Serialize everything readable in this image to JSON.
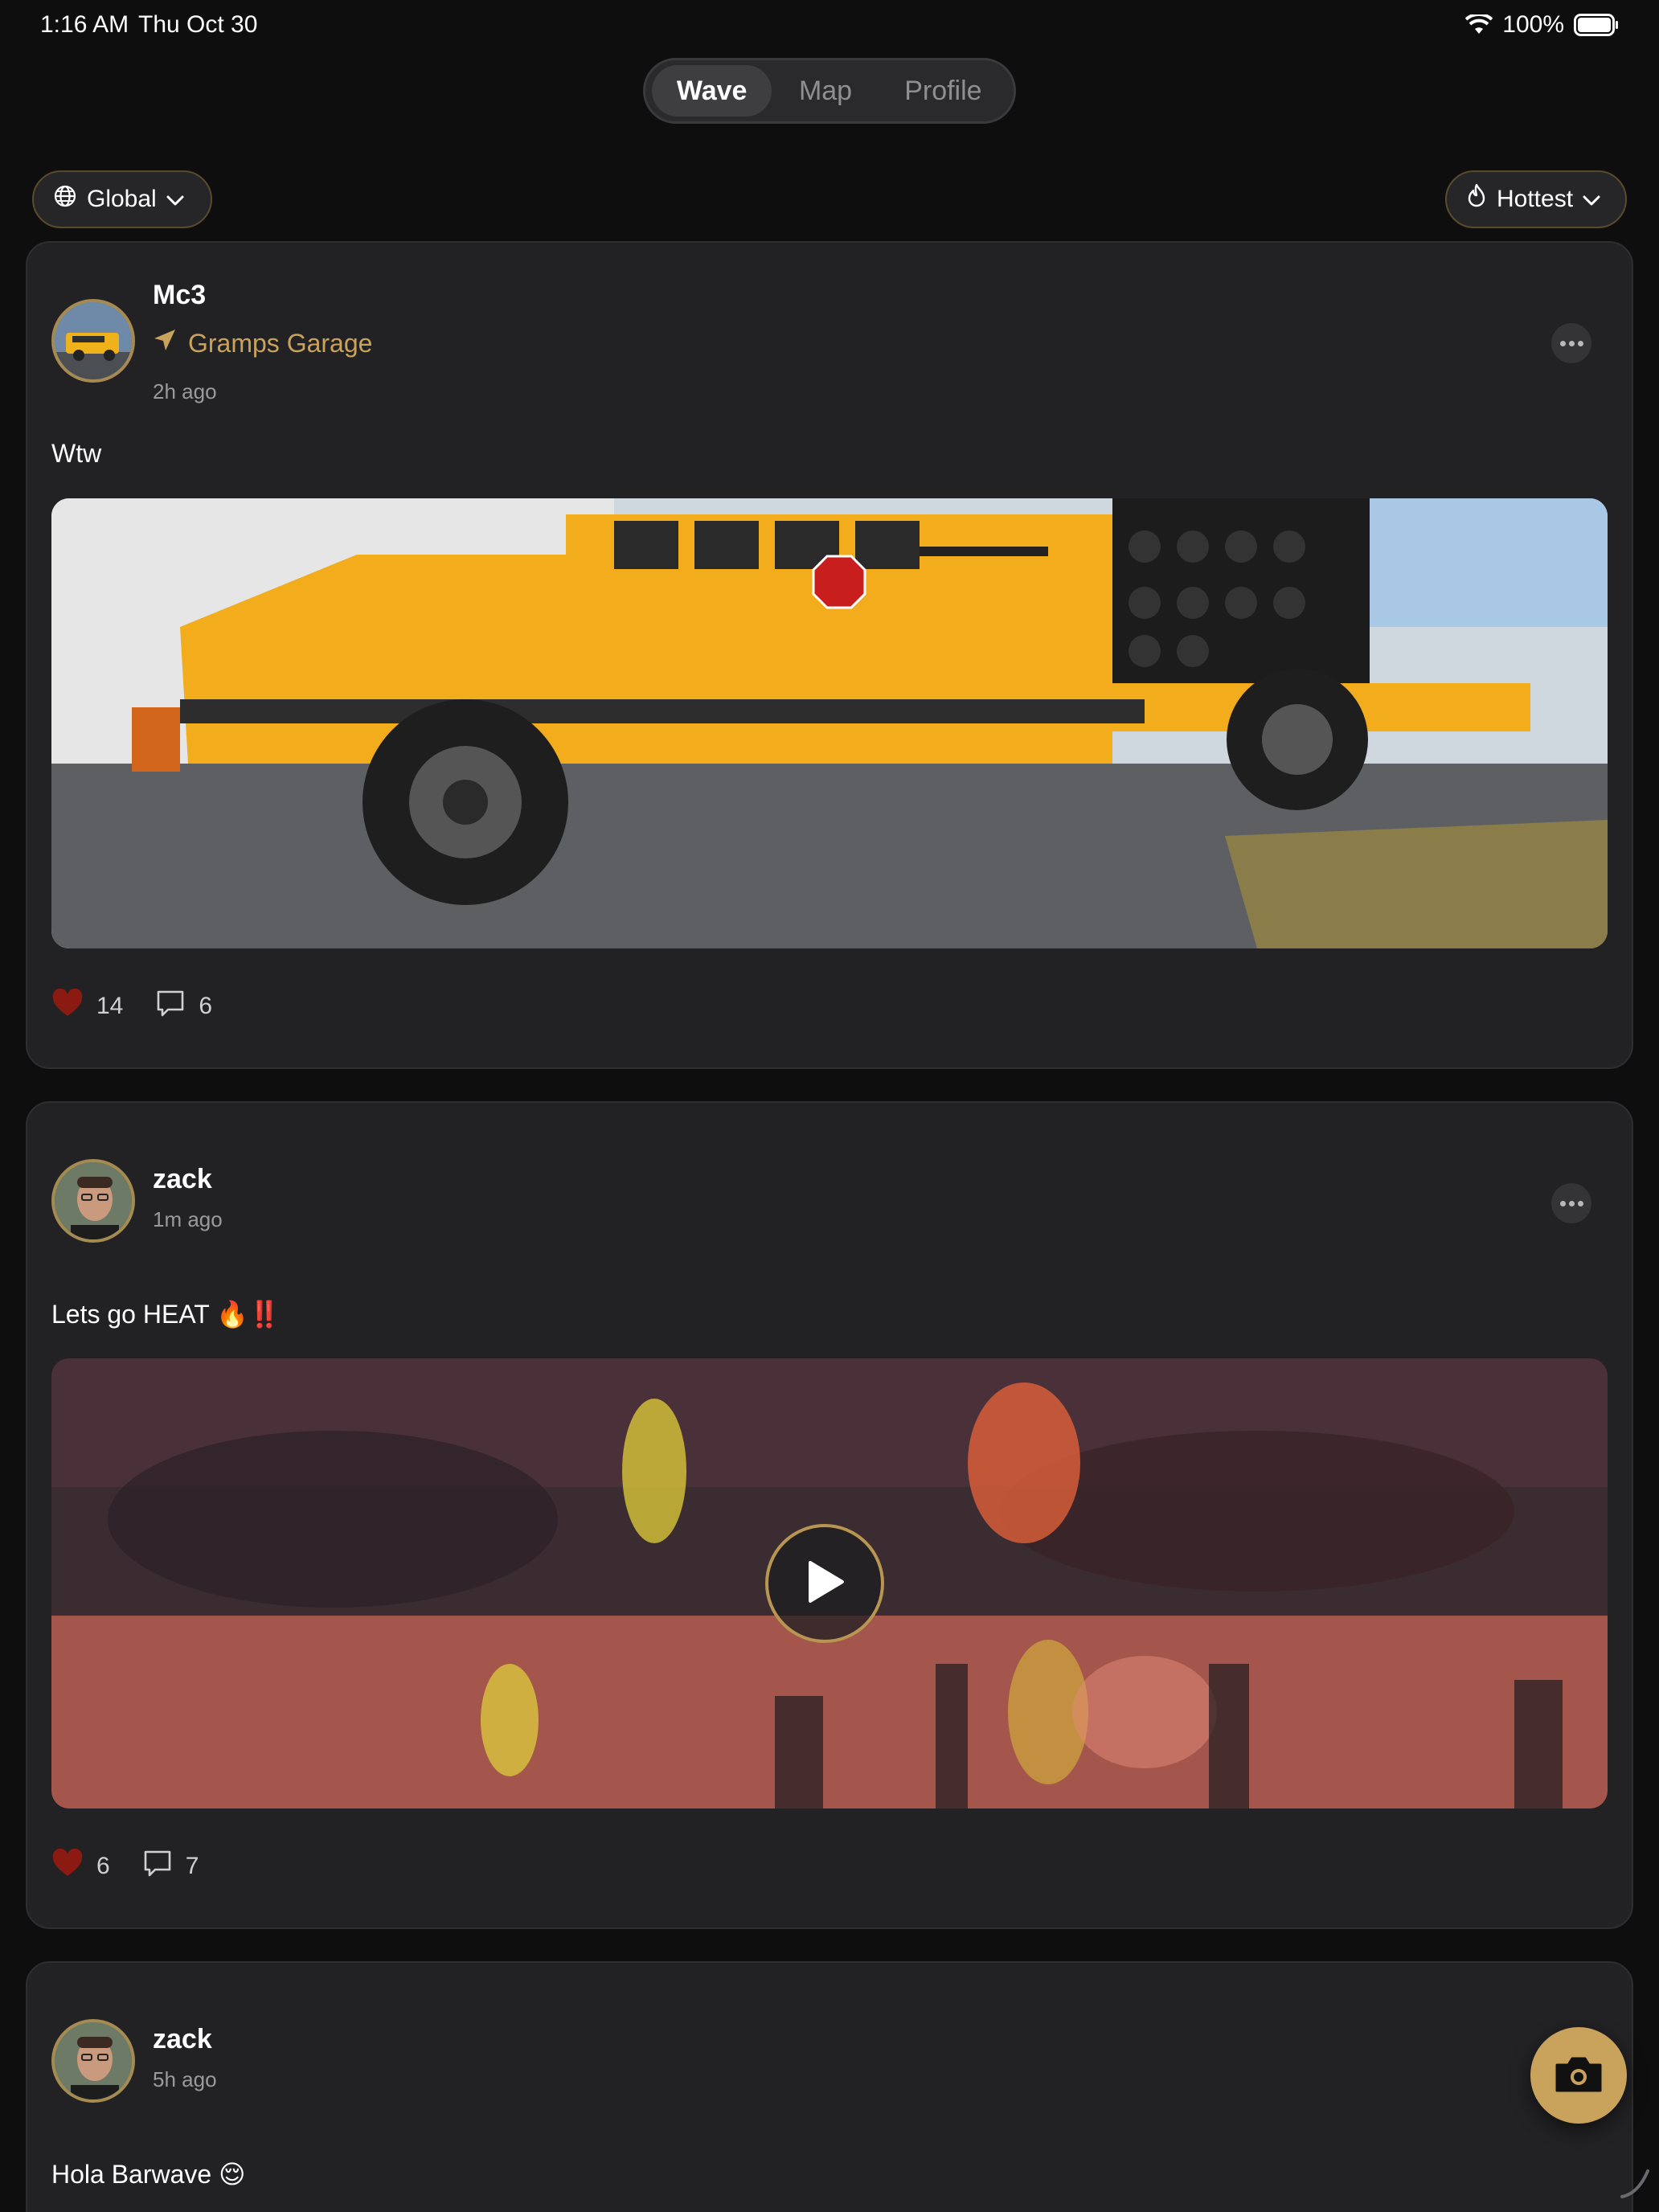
{
  "status_bar": {
    "time": "1:16 AM",
    "date": "Thu Oct 30",
    "battery": "100%"
  },
  "tabs": {
    "items": [
      "Wave",
      "Map",
      "Profile"
    ],
    "active": "Wave"
  },
  "filters": {
    "scope": "Global",
    "sort": "Hottest"
  },
  "posts": [
    {
      "username": "Mc3",
      "location": "Gramps Garage",
      "time": "2h ago",
      "text": "Wtw",
      "likes": "14",
      "comments": "6"
    },
    {
      "username": "zack",
      "time": "1m ago",
      "text": "Lets go HEAT 🔥‼️",
      "likes": "6",
      "comments": "7"
    },
    {
      "username": "zack",
      "time": "5h ago",
      "text": "Hola Barwave 😌"
    }
  ],
  "colors": {
    "accent": "#c9a25c",
    "background": "#0e0e0f",
    "card": "#222224",
    "like": "#8b1a12"
  }
}
